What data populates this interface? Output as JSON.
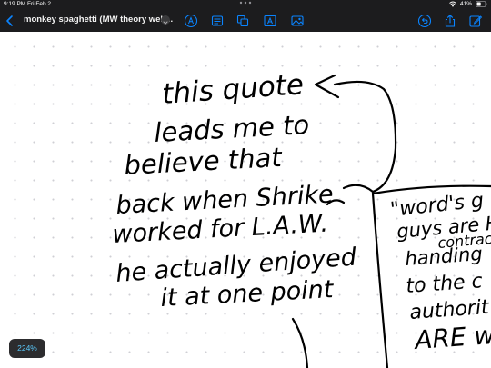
{
  "status_bar": {
    "time": "9:19 PM",
    "date": "Fri Feb 2",
    "battery": "41%"
  },
  "toolbar": {
    "title": "monkey spaghetti (MW theory web...",
    "tools": [
      "pen-tool-icon",
      "text-box-icon",
      "shapes-icon",
      "text-insert-icon",
      "image-insert-icon"
    ],
    "actions": [
      "undo-icon",
      "share-icon",
      "edit-icon"
    ]
  },
  "canvas": {
    "handwritten_notes": [
      "this quote",
      "leads me to",
      "believe that",
      "back when Shrike",
      "worked for L.A.W.",
      "he actually enjoyed",
      "it at one point"
    ],
    "side_box_text": [
      "\"word's g",
      "guys are H",
      "contrac",
      "handing",
      "to the c",
      "authorit",
      "ARE w"
    ]
  },
  "zoom": {
    "label": "224%"
  },
  "colors": {
    "toolbar_bg": "#1c1c1e",
    "accent": "#0a84ff",
    "zoom_text": "#5ac8fa",
    "ink": "#000000"
  }
}
